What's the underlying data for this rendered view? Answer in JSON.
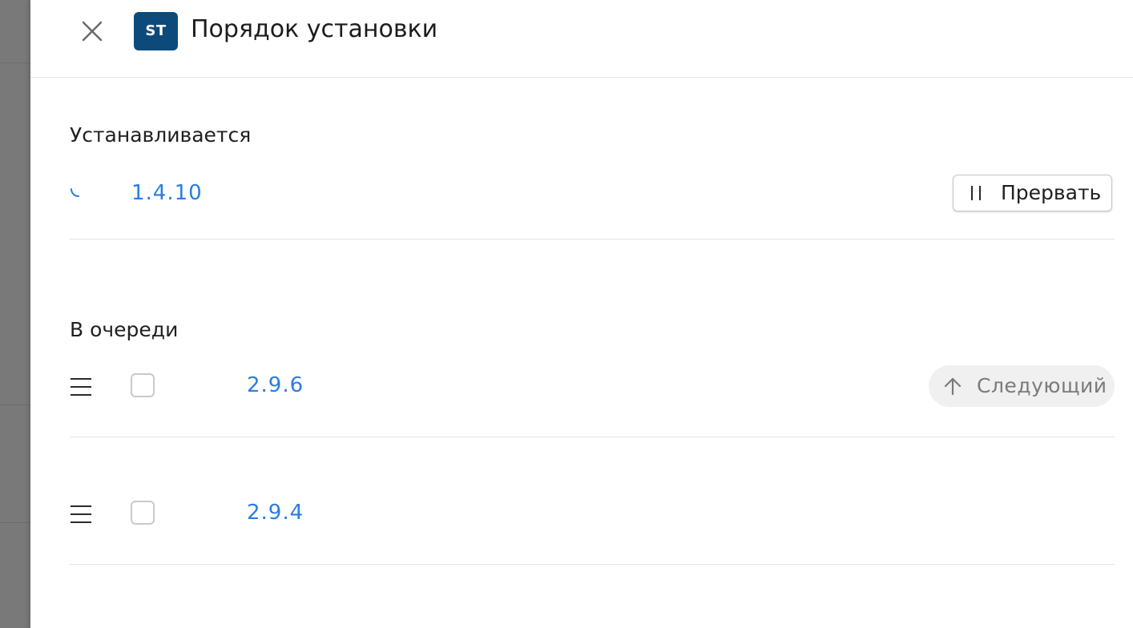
{
  "header": {
    "badge_text": "ST",
    "title": "Порядок установки"
  },
  "installing": {
    "section_title": "Устанавливается",
    "version": "1.4.10",
    "abort_label": "Прервать"
  },
  "queue": {
    "section_title": "В очереди",
    "items": [
      {
        "version": "2.9.6",
        "next_label": "Следующий",
        "checked": false
      },
      {
        "version": "2.9.4",
        "checked": false
      }
    ]
  },
  "colors": {
    "accent": "#2a7de1",
    "badge": "#0d4a7a",
    "backdrop": "#797979"
  },
  "icons": [
    "close-icon",
    "spinner-icon",
    "pause-icon",
    "drag-handle-icon",
    "arrow-up-icon"
  ]
}
